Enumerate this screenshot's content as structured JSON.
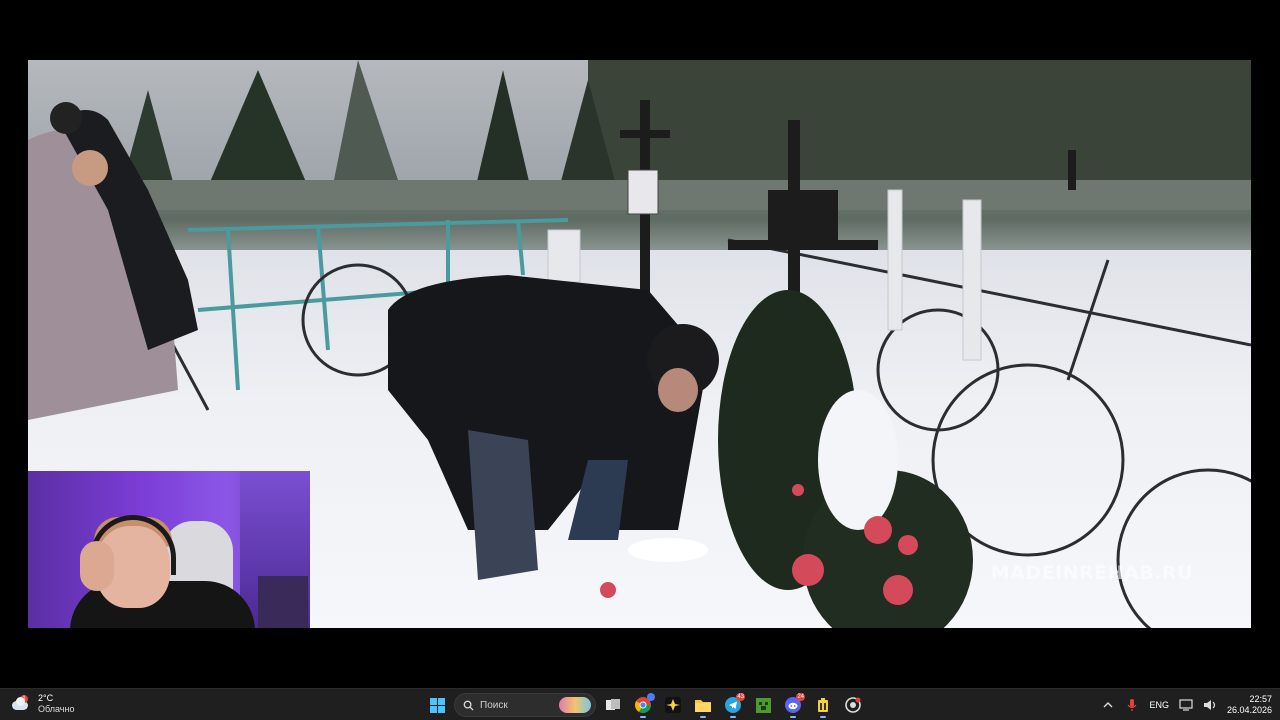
{
  "video": {
    "watermark": "MADEINREHAB.RU"
  },
  "taskbar": {
    "weather": {
      "temp": "2°C",
      "desc": "Облачно",
      "badge": "1"
    },
    "search": {
      "placeholder": "Поиск"
    },
    "apps": [
      {
        "name": "start",
        "icon": "windows-logo-icon"
      },
      {
        "name": "task-view",
        "icon": "task-view-icon"
      },
      {
        "name": "chrome",
        "icon": "chrome-icon",
        "badge": ""
      },
      {
        "name": "obs",
        "icon": "star-app-icon"
      },
      {
        "name": "explorer",
        "icon": "folder-icon"
      },
      {
        "name": "telegram",
        "icon": "telegram-icon",
        "badge": "43"
      },
      {
        "name": "minecraft",
        "icon": "minecraft-icon"
      },
      {
        "name": "discord",
        "icon": "discord-icon",
        "badge": "24"
      },
      {
        "name": "app",
        "icon": "battery-app-icon"
      },
      {
        "name": "record",
        "icon": "record-icon"
      }
    ],
    "tray": {
      "language": "ENG"
    },
    "clock": {
      "time": "22:57",
      "date": "26.04.2026"
    }
  },
  "colors": {
    "taskbar_bg": "#1f1f1f",
    "accent": "#4cc2ff",
    "webcam_purple": "#7b3dd6"
  }
}
